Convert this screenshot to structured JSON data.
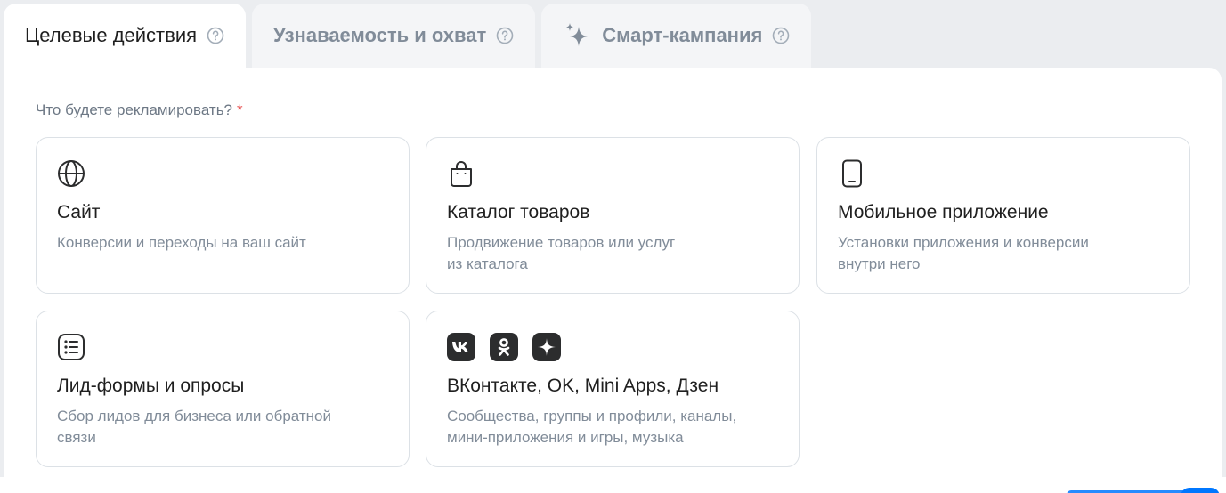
{
  "tabs": [
    {
      "label": "Целевые действия",
      "active": true
    },
    {
      "label": "Узнаваемость и охват",
      "active": false
    },
    {
      "label": "Смарт-кампания",
      "active": false
    }
  ],
  "question": {
    "label": "Что будете рекламировать?",
    "required_mark": "*"
  },
  "cards": [
    {
      "icon": "globe-icon",
      "title": "Сайт",
      "description": "Конверсии и переходы на ваш сайт"
    },
    {
      "icon": "shopping-bag-icon",
      "title": "Каталог товаров",
      "description": "Продвижение товаров или услуг\nиз каталога"
    },
    {
      "icon": "smartphone-icon",
      "title": "Мобильное приложение",
      "description": "Установки приложения и конверсии\nвнутри него"
    },
    {
      "icon": "list-form-icon",
      "title": "Лид-формы и опросы",
      "description": "Сбор лидов для бизнеса или обратной\nсвязи"
    },
    {
      "icon": [
        "vk-logo-icon",
        "ok-logo-icon",
        "dzen-logo-icon"
      ],
      "title": "ВКонтакте, OK, Mini Apps, Дзен",
      "description": "Сообщества, группы и профили, каналы,\nмини-приложения и игры, музыка"
    }
  ],
  "colors": {
    "background": "#ebedf0",
    "card_border": "#dce1e6",
    "muted_text": "#818c99",
    "required": "#e64646",
    "accent": "#0077ff"
  }
}
